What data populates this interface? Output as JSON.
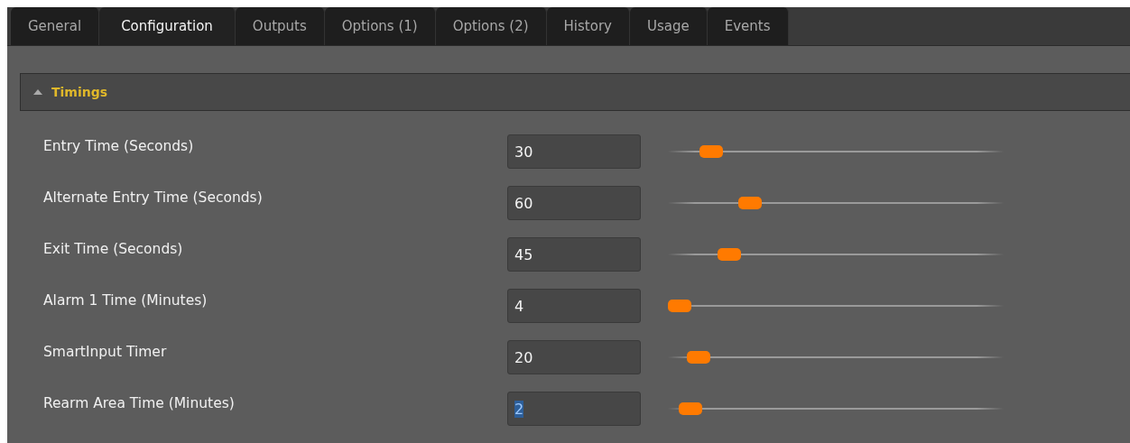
{
  "tabs": [
    {
      "label": "General",
      "selected": false
    },
    {
      "label": "Configuration",
      "selected": true
    },
    {
      "label": "Outputs",
      "selected": false
    },
    {
      "label": "Options (1)",
      "selected": false
    },
    {
      "label": "Options (2)",
      "selected": false
    },
    {
      "label": "History",
      "selected": false
    },
    {
      "label": "Usage",
      "selected": false
    },
    {
      "label": "Events",
      "selected": false
    }
  ],
  "section": {
    "title": "Timings",
    "expanded": true,
    "rows": [
      {
        "label": "Entry Time (Seconds)",
        "value": "30",
        "text_selected": false,
        "level": 0.1
      },
      {
        "label": "Alternate Entry Time (Seconds)",
        "value": "60",
        "text_selected": false,
        "level": 0.225
      },
      {
        "label": "Exit Time (Seconds)",
        "value": "45",
        "text_selected": false,
        "level": 0.16
      },
      {
        "label": "Alarm 1 Time (Minutes)",
        "value": "4",
        "text_selected": false,
        "level": 0
      },
      {
        "label": "SmartInput Timer",
        "value": "20",
        "text_selected": false,
        "level": 0.06
      },
      {
        "label": "Rearm Area Time (Minutes)",
        "value": "2",
        "text_selected": true,
        "level": 0.035
      }
    ]
  }
}
